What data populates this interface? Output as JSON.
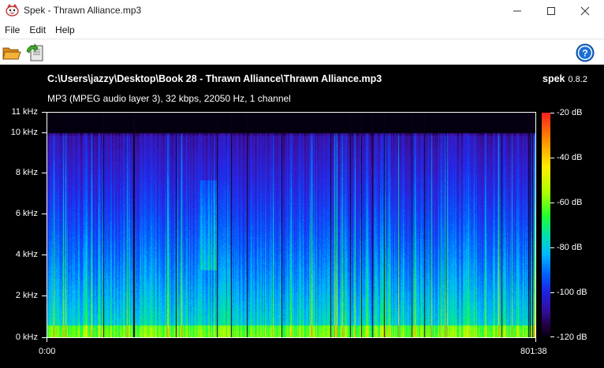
{
  "window": {
    "title": "Spek - Thrawn Alliance.mp3"
  },
  "menu": {
    "items": [
      "File",
      "Edit",
      "Help"
    ]
  },
  "toolbar": {
    "open_icon": "folder-open-icon",
    "save_icon": "save-arrow-icon",
    "help_icon": "help-icon"
  },
  "header": {
    "file_path": "C:\\Users\\jazzy\\Desktop\\Book 28 - Thrawn Alliance\\Thrawn Alliance.mp3",
    "file_info": "MP3 (MPEG audio layer 3), 32 kbps, 22050 Hz, 1 channel",
    "brand": "spek",
    "version": "0.8.2"
  },
  "axes": {
    "y_labels": [
      "11 kHz",
      "10 kHz",
      "8 kHz",
      "6 kHz",
      "4 kHz",
      "2 kHz",
      "0 kHz"
    ],
    "x_labels": [
      "0:00",
      "801:38"
    ],
    "db_labels": [
      "-20 dB",
      "-40 dB",
      "-60 dB",
      "-80 dB",
      "-100 dB",
      "-120 dB"
    ]
  },
  "colors": {
    "background": "#000000",
    "accent_help": "#1a6fd6"
  }
}
